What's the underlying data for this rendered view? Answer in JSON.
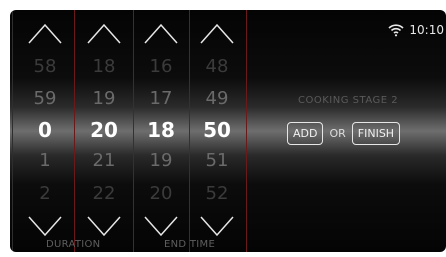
{
  "status": {
    "time": "10:10",
    "wifi_icon": "wifi-icon"
  },
  "columns": [
    {
      "name": "duration-hours",
      "values": [
        "58",
        "59",
        "0",
        "1",
        "2"
      ],
      "selected_index": 2
    },
    {
      "name": "duration-minutes",
      "values": [
        "18",
        "19",
        "20",
        "21",
        "22"
      ],
      "selected_index": 2
    },
    {
      "name": "end-hours",
      "values": [
        "16",
        "17",
        "18",
        "19",
        "20"
      ],
      "selected_index": 2
    },
    {
      "name": "end-minutes",
      "values": [
        "48",
        "49",
        "50",
        "51",
        "52"
      ],
      "selected_index": 2
    }
  ],
  "labels": {
    "duration": "DURATION",
    "end_time": "END TIME"
  },
  "stage": {
    "title": "COOKING STAGE 2",
    "add_label": "ADD",
    "or_label": "OR",
    "finish_label": "FINISH"
  },
  "colors": {
    "divider": "#6a1a1a",
    "selected_text": "#ffffff",
    "faint_text": "#3b3b3b"
  }
}
